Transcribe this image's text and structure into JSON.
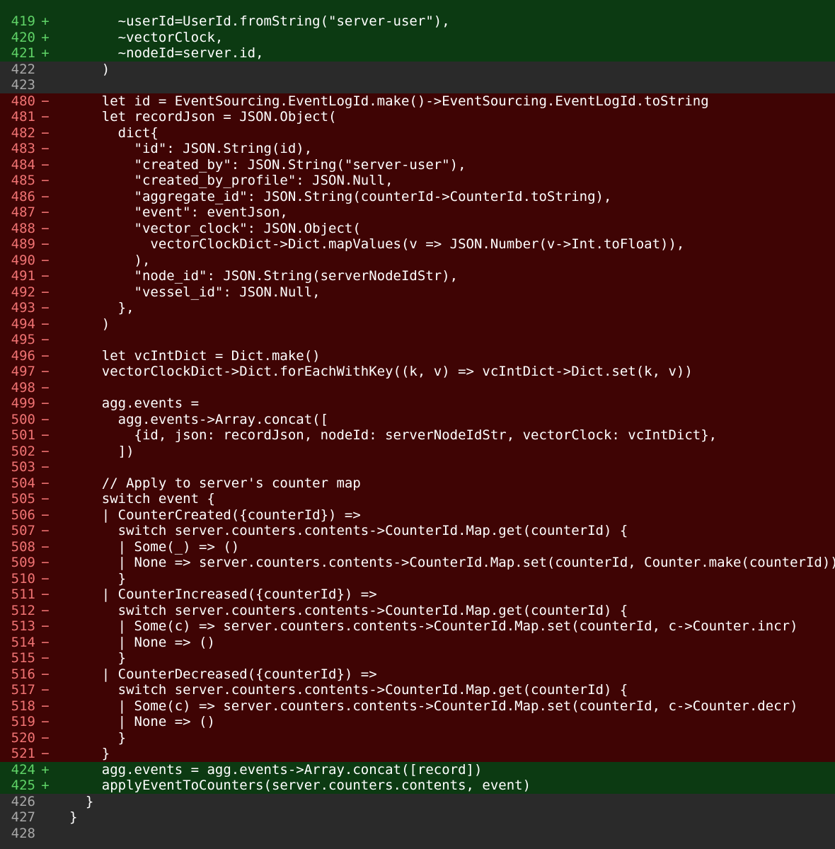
{
  "colors": {
    "added_bg": "#0c3a12",
    "removed_bg": "#3f0404",
    "context_bg": "#2a2a2a",
    "added_gutter": "#5fd367",
    "removed_gutter": "#f07373",
    "context_gutter": "#a8a8a8"
  },
  "lines": [
    {
      "num": "419",
      "mark": "+",
      "type": "added",
      "text": "      ~userId=UserId.fromString(\"server-user\"),"
    },
    {
      "num": "420",
      "mark": "+",
      "type": "added",
      "text": "      ~vectorClock,"
    },
    {
      "num": "421",
      "mark": "+",
      "type": "added",
      "text": "      ~nodeId=server.id,"
    },
    {
      "num": "422",
      "mark": "",
      "type": "context",
      "text": "    )"
    },
    {
      "num": "423",
      "mark": "",
      "type": "context",
      "text": ""
    },
    {
      "num": "480",
      "mark": "−",
      "type": "removed",
      "text": "    let id = EventSourcing.EventLogId.make()->EventSourcing.EventLogId.toString"
    },
    {
      "num": "481",
      "mark": "−",
      "type": "removed",
      "text": "    let recordJson = JSON.Object("
    },
    {
      "num": "482",
      "mark": "−",
      "type": "removed",
      "text": "      dict{"
    },
    {
      "num": "483",
      "mark": "−",
      "type": "removed",
      "text": "        \"id\": JSON.String(id),"
    },
    {
      "num": "484",
      "mark": "−",
      "type": "removed",
      "text": "        \"created_by\": JSON.String(\"server-user\"),"
    },
    {
      "num": "485",
      "mark": "−",
      "type": "removed",
      "text": "        \"created_by_profile\": JSON.Null,"
    },
    {
      "num": "486",
      "mark": "−",
      "type": "removed",
      "text": "        \"aggregate_id\": JSON.String(counterId->CounterId.toString),"
    },
    {
      "num": "487",
      "mark": "−",
      "type": "removed",
      "text": "        \"event\": eventJson,"
    },
    {
      "num": "488",
      "mark": "−",
      "type": "removed",
      "text": "        \"vector_clock\": JSON.Object("
    },
    {
      "num": "489",
      "mark": "−",
      "type": "removed",
      "text": "          vectorClockDict->Dict.mapValues(v => JSON.Number(v->Int.toFloat)),"
    },
    {
      "num": "490",
      "mark": "−",
      "type": "removed",
      "text": "        ),"
    },
    {
      "num": "491",
      "mark": "−",
      "type": "removed",
      "text": "        \"node_id\": JSON.String(serverNodeIdStr),"
    },
    {
      "num": "492",
      "mark": "−",
      "type": "removed",
      "text": "        \"vessel_id\": JSON.Null,"
    },
    {
      "num": "493",
      "mark": "−",
      "type": "removed",
      "text": "      },"
    },
    {
      "num": "494",
      "mark": "−",
      "type": "removed",
      "text": "    )"
    },
    {
      "num": "495",
      "mark": "−",
      "type": "removed",
      "text": ""
    },
    {
      "num": "496",
      "mark": "−",
      "type": "removed",
      "text": "    let vcIntDict = Dict.make()"
    },
    {
      "num": "497",
      "mark": "−",
      "type": "removed",
      "text": "    vectorClockDict->Dict.forEachWithKey((k, v) => vcIntDict->Dict.set(k, v))"
    },
    {
      "num": "498",
      "mark": "−",
      "type": "removed",
      "text": ""
    },
    {
      "num": "499",
      "mark": "−",
      "type": "removed",
      "text": "    agg.events ="
    },
    {
      "num": "500",
      "mark": "−",
      "type": "removed",
      "text": "      agg.events->Array.concat(["
    },
    {
      "num": "501",
      "mark": "−",
      "type": "removed",
      "text": "        {id, json: recordJson, nodeId: serverNodeIdStr, vectorClock: vcIntDict},"
    },
    {
      "num": "502",
      "mark": "−",
      "type": "removed",
      "text": "      ])"
    },
    {
      "num": "503",
      "mark": "−",
      "type": "removed",
      "text": ""
    },
    {
      "num": "504",
      "mark": "−",
      "type": "removed",
      "text": "    // Apply to server's counter map"
    },
    {
      "num": "505",
      "mark": "−",
      "type": "removed",
      "text": "    switch event {"
    },
    {
      "num": "506",
      "mark": "−",
      "type": "removed",
      "text": "    | CounterCreated({counterId}) =>"
    },
    {
      "num": "507",
      "mark": "−",
      "type": "removed",
      "text": "      switch server.counters.contents->CounterId.Map.get(counterId) {"
    },
    {
      "num": "508",
      "mark": "−",
      "type": "removed",
      "text": "      | Some(_) => ()"
    },
    {
      "num": "509",
      "mark": "−",
      "type": "removed",
      "text": "      | None => server.counters.contents->CounterId.Map.set(counterId, Counter.make(counterId))"
    },
    {
      "num": "510",
      "mark": "−",
      "type": "removed",
      "text": "      }"
    },
    {
      "num": "511",
      "mark": "−",
      "type": "removed",
      "text": "    | CounterIncreased({counterId}) =>"
    },
    {
      "num": "512",
      "mark": "−",
      "type": "removed",
      "text": "      switch server.counters.contents->CounterId.Map.get(counterId) {"
    },
    {
      "num": "513",
      "mark": "−",
      "type": "removed",
      "text": "      | Some(c) => server.counters.contents->CounterId.Map.set(counterId, c->Counter.incr)"
    },
    {
      "num": "514",
      "mark": "−",
      "type": "removed",
      "text": "      | None => ()"
    },
    {
      "num": "515",
      "mark": "−",
      "type": "removed",
      "text": "      }"
    },
    {
      "num": "516",
      "mark": "−",
      "type": "removed",
      "text": "    | CounterDecreased({counterId}) =>"
    },
    {
      "num": "517",
      "mark": "−",
      "type": "removed",
      "text": "      switch server.counters.contents->CounterId.Map.get(counterId) {"
    },
    {
      "num": "518",
      "mark": "−",
      "type": "removed",
      "text": "      | Some(c) => server.counters.contents->CounterId.Map.set(counterId, c->Counter.decr)"
    },
    {
      "num": "519",
      "mark": "−",
      "type": "removed",
      "text": "      | None => ()"
    },
    {
      "num": "520",
      "mark": "−",
      "type": "removed",
      "text": "      }"
    },
    {
      "num": "521",
      "mark": "−",
      "type": "removed",
      "text": "    }"
    },
    {
      "num": "424",
      "mark": "+",
      "type": "added",
      "text": "    agg.events = agg.events->Array.concat([record])"
    },
    {
      "num": "425",
      "mark": "+",
      "type": "added",
      "text": "    applyEventToCounters(server.counters.contents, event)"
    },
    {
      "num": "426",
      "mark": "",
      "type": "context",
      "text": "  }"
    },
    {
      "num": "427",
      "mark": "",
      "type": "context",
      "text": "}"
    },
    {
      "num": "428",
      "mark": "",
      "type": "context",
      "text": ""
    }
  ]
}
